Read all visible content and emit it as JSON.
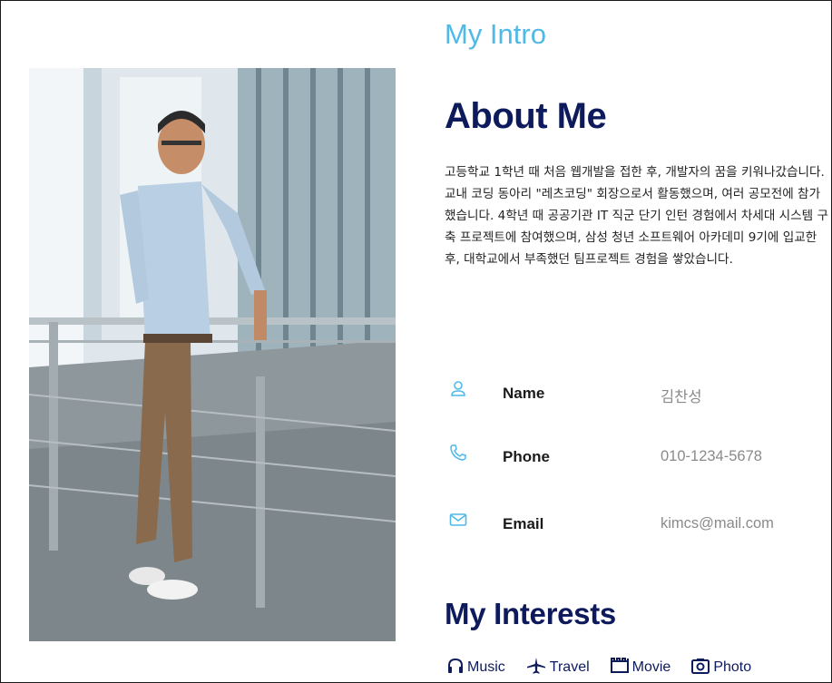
{
  "intro": {
    "title": "My Intro"
  },
  "about": {
    "title": "About Me",
    "text": "고등학교 1학년 때 처음 웹개발을 접한 후, 개발자의 꿈을 키워나갔습니다. 교내 코딩 동아리 \"레츠코딩\" 회장으로서 활동했으며, 여러 공모전에 참가했습니다. 4학년 때 공공기관 IT 직군 단기 인턴 경험에서 차세대 시스템 구축 프로젝트에 참여했으며, 삼성 청년 소프트웨어 아카데미 9기에 입교한 후, 대학교에서 부족했던 팀프로젝트 경험을 쌓았습니다."
  },
  "contact": [
    {
      "icon": "user-icon",
      "label": "Name",
      "value": "김찬성"
    },
    {
      "icon": "phone-icon",
      "label": "Phone",
      "value": "010-1234-5678"
    },
    {
      "icon": "mail-icon",
      "label": "Email",
      "value": "kimcs@mail.com"
    }
  ],
  "interests": {
    "title": "My Interests",
    "items": [
      {
        "icon": "headphones-icon",
        "label": "Music"
      },
      {
        "icon": "airplane-icon",
        "label": "Travel"
      },
      {
        "icon": "film-icon",
        "label": "Movie"
      },
      {
        "icon": "camera-icon",
        "label": "Photo"
      }
    ]
  },
  "colors": {
    "accent": "#4fb9e8",
    "heading": "#0d1a5c",
    "muted": "#8a8a8a"
  }
}
